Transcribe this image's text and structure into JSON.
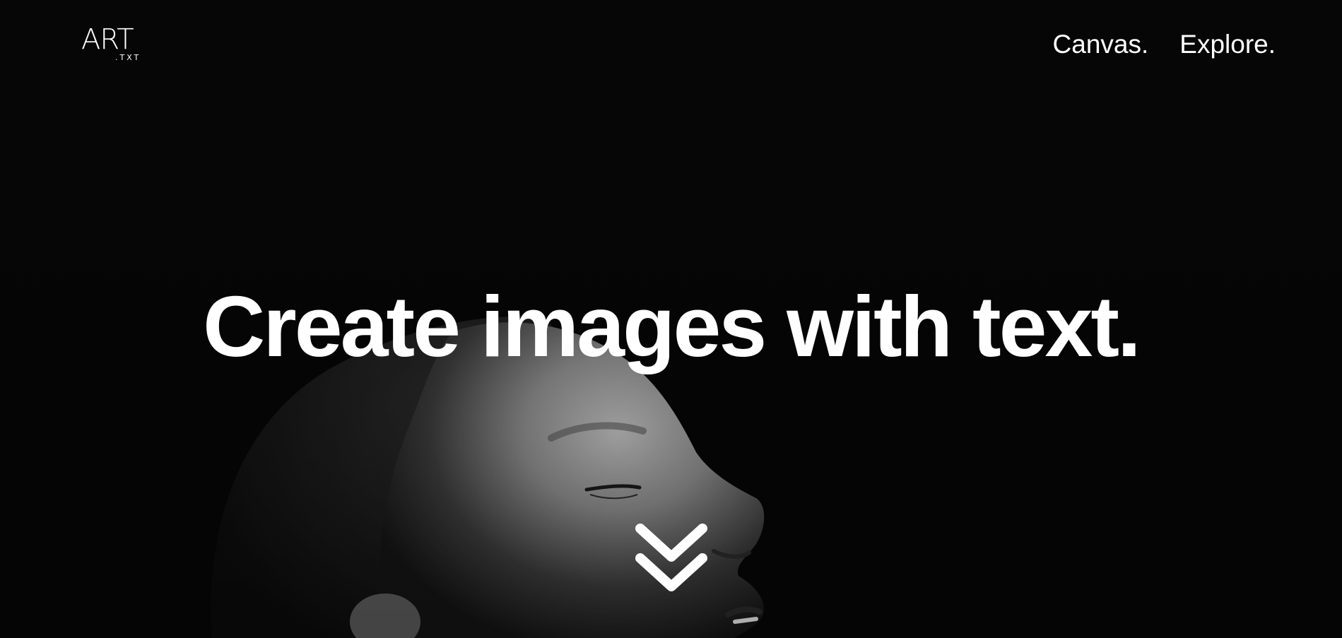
{
  "header": {
    "logo": {
      "main": "ART",
      "sub": ".TXT"
    },
    "nav": [
      {
        "label": "Canvas."
      },
      {
        "label": "Explore."
      }
    ]
  },
  "hero": {
    "headline": "Create images with text.",
    "scroll_icon": "double-chevron-down-icon",
    "photo": "black-and-white-portrait-profile"
  },
  "colors": {
    "background": "#060606",
    "text": "#ffffff"
  }
}
